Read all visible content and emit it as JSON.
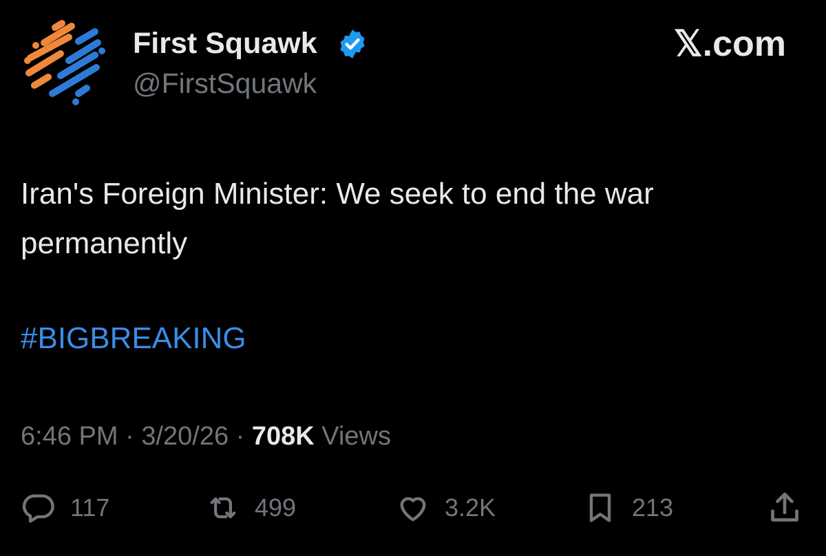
{
  "profile": {
    "display_name": "First Squawk",
    "handle": "@FirstSquawk",
    "verified": true
  },
  "brand": {
    "label": "𝕏.com"
  },
  "tweet": {
    "text": "Iran's Foreign Minister: We seek to end the war permanently",
    "hashtag": "#BIGBREAKING"
  },
  "meta": {
    "time": "6:46 PM",
    "separator": "·",
    "date": "3/20/26",
    "views_count": "708K",
    "views_label": "Views"
  },
  "actions": {
    "reply_count": "117",
    "repost_count": "499",
    "like_count": "3.2K",
    "bookmark_count": "213"
  },
  "icons": {
    "avatar": "first-squawk-logo",
    "verified": "verified-badge-icon",
    "reply": "reply-icon",
    "repost": "repost-icon",
    "like": "heart-icon",
    "bookmark": "bookmark-icon",
    "share": "share-icon"
  },
  "colors": {
    "background": "#000000",
    "text_primary": "#e7e9ea",
    "text_secondary": "#71767b",
    "hashtag": "#3c8ce8",
    "verified": "#1d9bf0",
    "logo_orange": "#f0883c",
    "logo_blue": "#2f7ad6"
  }
}
